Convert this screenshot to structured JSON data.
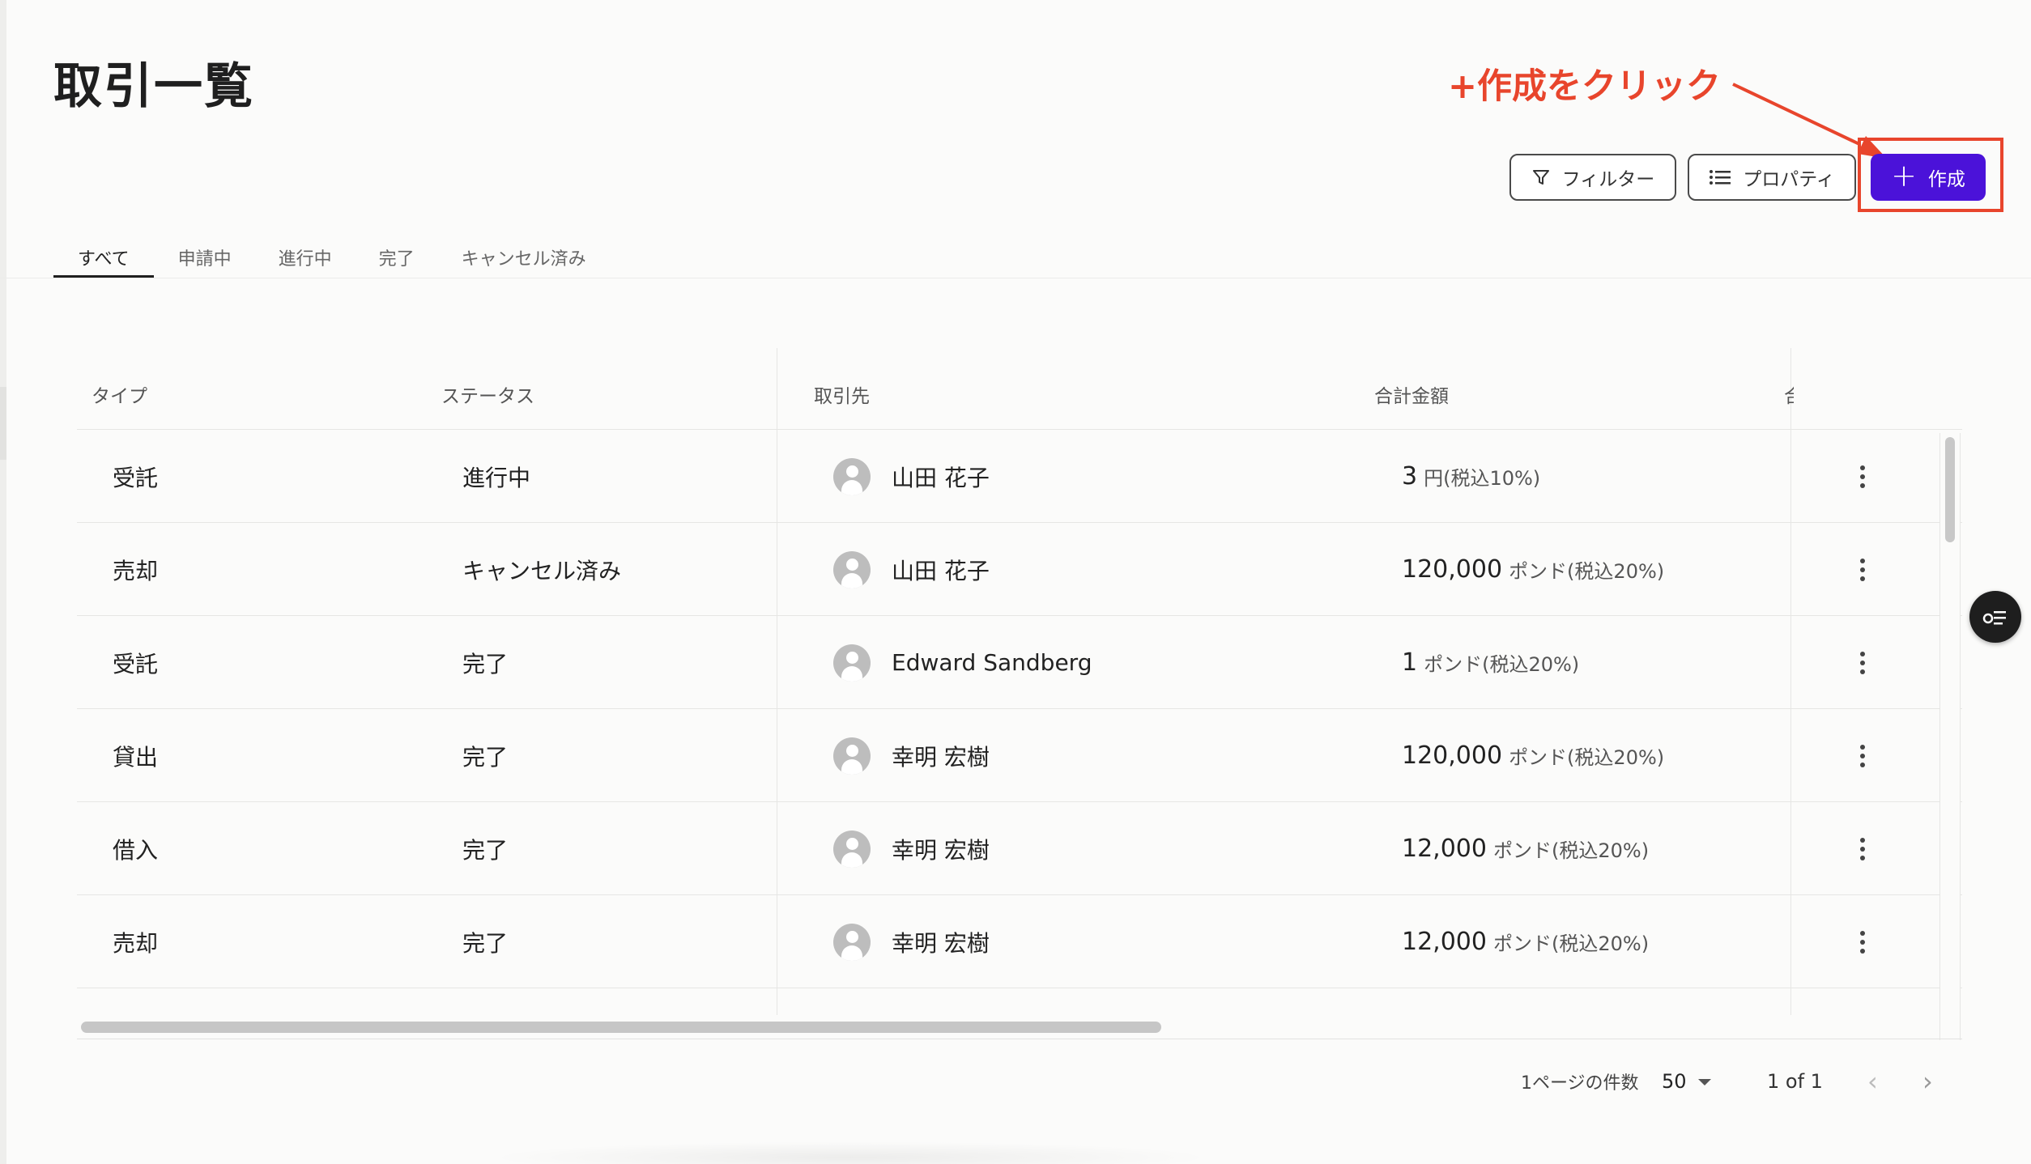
{
  "page": {
    "title": "取引一覧"
  },
  "annotation": {
    "text": "+作成をクリック",
    "color": "#e8452c"
  },
  "toolbar": {
    "filter_label": "フィルター",
    "filter_icon": "filter-icon",
    "properties_label": "プロパティ",
    "properties_icon": "list-icon",
    "create_label": "作成",
    "create_icon": "plus-icon",
    "create_color": "#4b12d9"
  },
  "tabs": [
    {
      "label": "すべて",
      "active": true
    },
    {
      "label": "申請中",
      "active": false
    },
    {
      "label": "進行中",
      "active": false
    },
    {
      "label": "完了",
      "active": false
    },
    {
      "label": "キャンセル済み",
      "active": false
    }
  ],
  "table": {
    "columns": [
      "タイプ",
      "ステータス",
      "取引先",
      "合計金額",
      "合"
    ],
    "rows": [
      {
        "type": "受託",
        "status": "進行中",
        "partner": "山田 花子",
        "amount": "3",
        "unit": "円(税込10%)"
      },
      {
        "type": "売却",
        "status": "キャンセル済み",
        "partner": "山田 花子",
        "amount": "120,000",
        "unit": "ポンド(税込20%)"
      },
      {
        "type": "受託",
        "status": "完了",
        "partner": "Edward Sandberg",
        "amount": "1",
        "unit": "ポンド(税込20%)"
      },
      {
        "type": "貸出",
        "status": "完了",
        "partner": "幸明 宏樹",
        "amount": "120,000",
        "unit": "ポンド(税込20%)"
      },
      {
        "type": "借入",
        "status": "完了",
        "partner": "幸明 宏樹",
        "amount": "12,000",
        "unit": "ポンド(税込20%)"
      },
      {
        "type": "売却",
        "status": "完了",
        "partner": "幸明 宏樹",
        "amount": "12,000",
        "unit": "ポンド(税込20%)"
      }
    ]
  },
  "pagination": {
    "per_page_label": "1ページの件数",
    "per_page_value": "50",
    "range": "1 of 1"
  }
}
